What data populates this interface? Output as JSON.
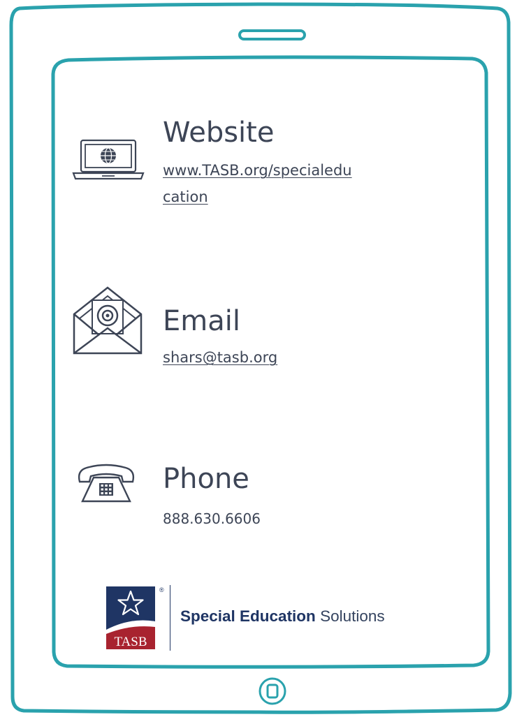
{
  "website": {
    "title": "Website",
    "url_line1": "www.TASB.org/specialedu",
    "url_line2": "cation"
  },
  "email": {
    "title": "Email",
    "address": "shars@tasb.org"
  },
  "phone": {
    "title": "Phone",
    "number": "888.630.6606"
  },
  "brand": {
    "logo_text": "TASB",
    "registered_mark": "®",
    "name_bold": "Special Education",
    "name_regular": " Solutions"
  },
  "icons": [
    "laptop-globe-icon",
    "envelope-at-icon",
    "telephone-icon",
    "home-button-icon",
    "speaker-slot-icon"
  ],
  "colors": {
    "frame": "#2aa2ad",
    "text": "#3d4556",
    "brand_navy": "#1f3564",
    "brand_red": "#a8232f"
  }
}
